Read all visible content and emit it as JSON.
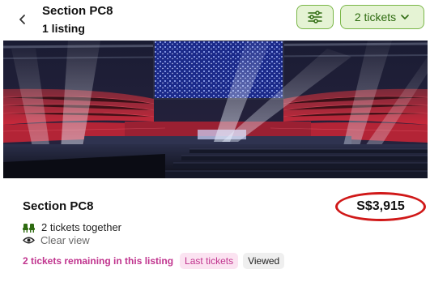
{
  "header": {
    "title": "Section PC8",
    "subtitle": "1 listing",
    "tickets_button_label": "2 tickets"
  },
  "listing": {
    "section": "Section PC8",
    "price": "S$3,915",
    "together_text": "2 tickets together",
    "view_text": "Clear view",
    "remaining_text": "2 tickets remaining in this listing",
    "badges": [
      "Last tickets",
      "Viewed"
    ]
  },
  "colors": {
    "accent_green": "#7ab648",
    "button_bg": "#e5f3d4",
    "highlight_pink": "#c0348e",
    "annotation_red": "#d01818"
  },
  "icons": {
    "back": "chevron-left-icon",
    "filter": "sliders-icon",
    "dropdown": "chevron-down-icon",
    "seats": "seat-icon",
    "view": "eye-icon"
  }
}
